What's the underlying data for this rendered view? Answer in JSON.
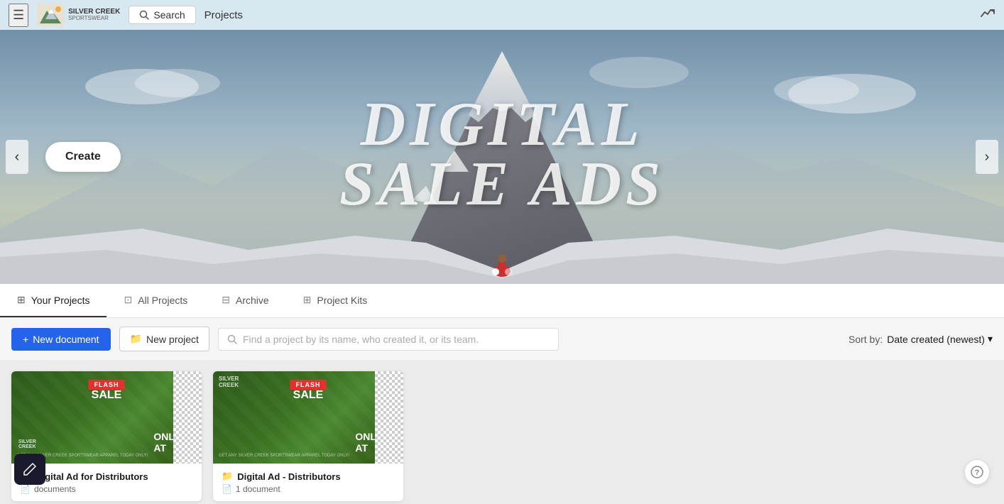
{
  "navbar": {
    "logo_text": "SILVER CREEK",
    "logo_subtitle": "SPORTSWEAR",
    "search_label": "Search",
    "projects_label": "Projects",
    "analytics_icon": "📈"
  },
  "hero": {
    "title_line1": "DIGITAL",
    "title_line2": "SALE ADS",
    "create_button": "Create",
    "prev_label": "‹",
    "next_label": "›",
    "dots": [
      {
        "active": true
      },
      {
        "active": false
      }
    ]
  },
  "tabs": [
    {
      "id": "your-projects",
      "label": "Your Projects",
      "icon": "⊞",
      "active": true
    },
    {
      "id": "all-projects",
      "label": "All Projects",
      "icon": "⊡",
      "active": false
    },
    {
      "id": "archive",
      "label": "Archive",
      "icon": "⊟",
      "active": false
    },
    {
      "id": "project-kits",
      "label": "Project Kits",
      "icon": "⊞",
      "active": false
    }
  ],
  "toolbar": {
    "new_doc_label": "New document",
    "new_project_label": "New project",
    "search_placeholder": "Find a project by its name, who created it, or its team.",
    "sort_label": "Sort by:",
    "sort_value": "Date created (newest)",
    "sort_icon": "▾"
  },
  "projects": [
    {
      "id": "proj-1",
      "name": "Digital Ad for Distributors",
      "documents": "documents",
      "doc_icon": "📄"
    },
    {
      "id": "proj-2",
      "name": "Digital Ad - Distributors",
      "documents": "1 document",
      "doc_icon": "📄"
    }
  ],
  "icons": {
    "hamburger": "☰",
    "search": "🔍",
    "folder": "📁",
    "plus": "+",
    "chevron_down": "▾",
    "edit": "✏",
    "help": "?"
  }
}
